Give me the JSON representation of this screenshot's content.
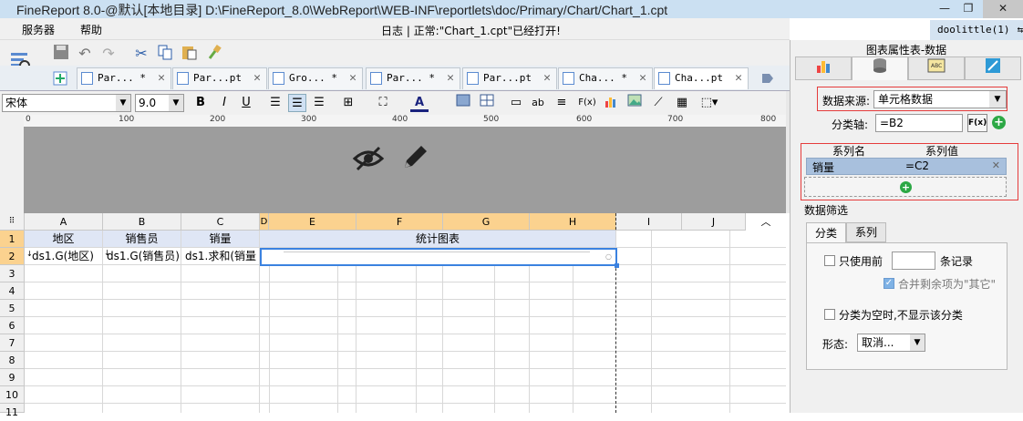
{
  "window": {
    "title": "FineReport 8.0-@默认[本地目录]    D:\\FineReport_8.0\\WebReport\\WEB-INF\\reportlets\\doc/Primary/Chart/Chart_1.cpt",
    "controls": [
      "—",
      "❐",
      "✕"
    ]
  },
  "menu": {
    "items": [
      "服务器",
      "帮助"
    ]
  },
  "status": {
    "message": "日志 | 正常:\"Chart_1.cpt\"已经打开!"
  },
  "user": {
    "name": "doolittle(1)",
    "exit_icon": "⇆"
  },
  "tabs": [
    {
      "label": "Par... *"
    },
    {
      "label": "Par...pt"
    },
    {
      "label": "Gro... *"
    },
    {
      "label": "Par... *"
    },
    {
      "label": "Par...pt"
    },
    {
      "label": "Cha... *"
    },
    {
      "label": "Cha...pt"
    }
  ],
  "format": {
    "font": "宋体",
    "size": "9.0",
    "bold": "B",
    "italic": "I",
    "underline": "U",
    "ab": "ab",
    "fx": "F(x)"
  },
  "ruler": {
    "ticks": [
      "0",
      "100",
      "200",
      "300",
      "400",
      "500",
      "600",
      "700",
      "800"
    ]
  },
  "sheet": {
    "columns": [
      "A",
      "B",
      "C",
      "D",
      "E",
      "F",
      "G",
      "H",
      "I",
      "J"
    ],
    "rows": [
      "1",
      "2",
      "3",
      "4",
      "5",
      "6",
      "7",
      "8",
      "9",
      "10",
      "11"
    ],
    "r1": {
      "a": "地区",
      "b": "销售员",
      "c": "销量",
      "merged": "统计图表"
    },
    "r2": {
      "a": "ds1.G(地区)",
      "b": "ds1.G(销售员)",
      "c": "ds1.求和(销量"
    }
  },
  "panel": {
    "title": "图表属性表-数据",
    "tab_icons": [
      "chart-type-icon",
      "data-icon",
      "style-icon",
      "effect-icon"
    ],
    "data_source_label": "数据来源:",
    "data_source_value": "单元格数据",
    "category_label": "分类轴:",
    "category_value": "=B2",
    "fx": "F(x)",
    "series_name_header": "系列名",
    "series_value_header": "系列值",
    "series_rows": [
      {
        "name": "销量",
        "value": "=C2"
      }
    ],
    "filter_title": "数据筛选",
    "filter_tabs": [
      "分类",
      "系列"
    ],
    "use_first_label": "只使用前",
    "records_label": "条记录",
    "merge_others_label": "合并剩余项为\"其它\"",
    "hide_empty_label": "分类为空时,不显示该分类",
    "shape_label": "形态:",
    "shape_value": "取消..."
  }
}
